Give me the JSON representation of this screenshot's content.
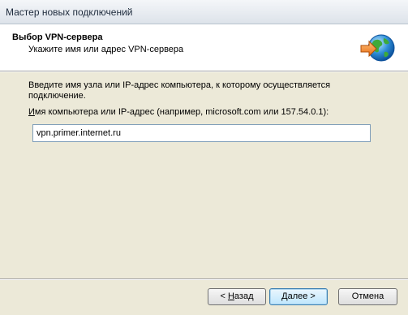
{
  "window": {
    "title": "Мастер новых подключений"
  },
  "header": {
    "heading": "Выбор VPN-сервера",
    "subheading": "Укажите имя или адрес VPN-сервера",
    "icon": "globe-arrow-icon"
  },
  "main": {
    "intro": "Введите имя узла или IP-адрес компьютера, к  которому осуществляется подключение.",
    "field_label_mnemonic": "И",
    "field_label_rest": "мя компьютера или IP-адрес (например, microsoft.com или 157.54.0.1):",
    "host_value": "vpn.primer.internet.ru"
  },
  "buttons": {
    "back_prefix": "< ",
    "back_mnemonic": "Н",
    "back_rest": "азад",
    "next_mnemonic": "Д",
    "next_rest": "алее >",
    "cancel": "Отмена"
  },
  "colors": {
    "accent": "#3C7FB1",
    "header_bg": "#FFFFFF",
    "dialog_bg": "#ECE9D8"
  }
}
